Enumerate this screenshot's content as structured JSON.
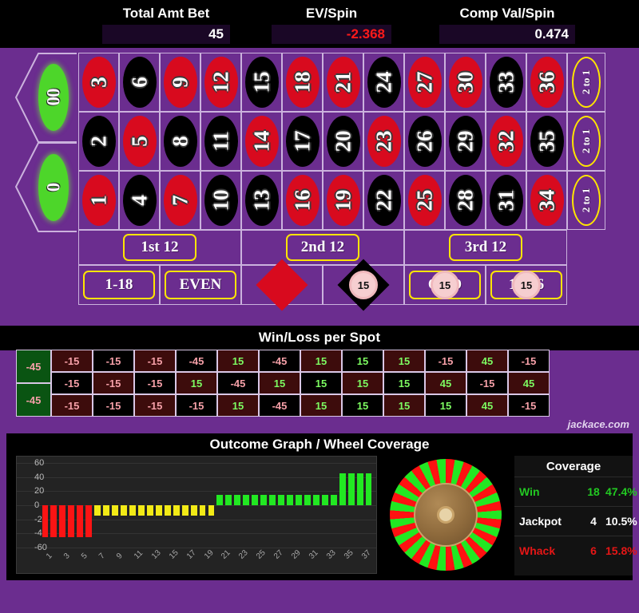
{
  "stats": {
    "items": [
      {
        "label": "Total Amt Bet",
        "value": "45",
        "negative": false
      },
      {
        "label": "EV/Spin",
        "value": "-2.368",
        "negative": true
      },
      {
        "label": "Comp Val/Spin",
        "value": "0.474",
        "negative": false
      }
    ]
  },
  "board": {
    "zeros": [
      {
        "label": "00",
        "name": "double-zero"
      },
      {
        "label": "0",
        "name": "zero"
      }
    ],
    "rows": [
      {
        "numbers": [
          {
            "n": "3",
            "c": "red"
          },
          {
            "n": "6",
            "c": "black"
          },
          {
            "n": "9",
            "c": "red"
          },
          {
            "n": "12",
            "c": "red"
          },
          {
            "n": "15",
            "c": "black"
          },
          {
            "n": "18",
            "c": "red"
          },
          {
            "n": "21",
            "c": "red"
          },
          {
            "n": "24",
            "c": "black"
          },
          {
            "n": "27",
            "c": "red"
          },
          {
            "n": "30",
            "c": "red"
          },
          {
            "n": "33",
            "c": "black"
          },
          {
            "n": "36",
            "c": "red"
          }
        ]
      },
      {
        "numbers": [
          {
            "n": "2",
            "c": "black"
          },
          {
            "n": "5",
            "c": "red"
          },
          {
            "n": "8",
            "c": "black"
          },
          {
            "n": "11",
            "c": "black"
          },
          {
            "n": "14",
            "c": "red"
          },
          {
            "n": "17",
            "c": "black"
          },
          {
            "n": "20",
            "c": "black"
          },
          {
            "n": "23",
            "c": "red"
          },
          {
            "n": "26",
            "c": "black"
          },
          {
            "n": "29",
            "c": "black"
          },
          {
            "n": "32",
            "c": "red"
          },
          {
            "n": "35",
            "c": "black"
          }
        ]
      },
      {
        "numbers": [
          {
            "n": "1",
            "c": "red"
          },
          {
            "n": "4",
            "c": "black"
          },
          {
            "n": "7",
            "c": "red"
          },
          {
            "n": "10",
            "c": "black"
          },
          {
            "n": "13",
            "c": "black"
          },
          {
            "n": "16",
            "c": "red"
          },
          {
            "n": "19",
            "c": "red"
          },
          {
            "n": "22",
            "c": "black"
          },
          {
            "n": "25",
            "c": "red"
          },
          {
            "n": "28",
            "c": "black"
          },
          {
            "n": "31",
            "c": "black"
          },
          {
            "n": "34",
            "c": "red"
          }
        ]
      }
    ],
    "column_bets": [
      "2 to 1",
      "2 to 1",
      "2 to 1"
    ],
    "dozens": [
      "1st 12",
      "2nd 12",
      "3rd 12"
    ],
    "outside": [
      {
        "label": "1-18",
        "kind": "text",
        "chip": null
      },
      {
        "label": "EVEN",
        "kind": "text",
        "chip": null
      },
      {
        "label": "RED",
        "kind": "diamond-red",
        "chip": null
      },
      {
        "label": "BLACK",
        "kind": "diamond-black",
        "chip": "15"
      },
      {
        "label": "ODD",
        "kind": "text",
        "chip": "15"
      },
      {
        "label": "19-36",
        "kind": "text",
        "chip": "15"
      }
    ]
  },
  "winloss": {
    "title": "Win/Loss per Spot",
    "zero_cells": [
      "-45",
      "-45"
    ],
    "rows": [
      [
        "-15",
        "-15",
        "-15",
        "-45",
        "15",
        "-45",
        "15",
        "15",
        "15",
        "-15",
        "45",
        "-15"
      ],
      [
        "-15",
        "-15",
        "-15",
        "15",
        "-45",
        "15",
        "15",
        "15",
        "15",
        "45",
        "-15",
        "45"
      ],
      [
        "-15",
        "-15",
        "-15",
        "-15",
        "15",
        "-45",
        "15",
        "15",
        "15",
        "15",
        "45",
        "-15"
      ]
    ],
    "watermark": "jackace.com"
  },
  "graph": {
    "title": "Outcome Graph / Wheel Coverage",
    "coverage": {
      "title": "Coverage",
      "rows": [
        {
          "label": "Win",
          "count": "18",
          "pct": "47.4%",
          "cls": "c-win"
        },
        {
          "label": "Jackpot",
          "count": "4",
          "pct": "10.5%",
          "cls": "c-jack"
        },
        {
          "label": "Whack",
          "count": "6",
          "pct": "15.8%",
          "cls": "c-whack"
        }
      ]
    }
  },
  "chart_data": {
    "type": "bar",
    "title": "Outcome Graph / Wheel Coverage",
    "xlabel": "",
    "ylabel": "",
    "ylim": [
      -60,
      60
    ],
    "yticks": [
      60,
      40,
      20,
      0,
      -20,
      -40,
      -60
    ],
    "xticks": [
      "1",
      "3",
      "5",
      "7",
      "9",
      "11",
      "13",
      "15",
      "17",
      "19",
      "21",
      "23",
      "25",
      "27",
      "29",
      "31",
      "33",
      "35",
      "37"
    ],
    "grid": true,
    "legend": null,
    "categories": [
      "1",
      "2",
      "3",
      "4",
      "5",
      "6",
      "7",
      "8",
      "9",
      "10",
      "11",
      "12",
      "13",
      "14",
      "15",
      "16",
      "17",
      "18",
      "19",
      "20",
      "21",
      "22",
      "23",
      "24",
      "25",
      "26",
      "27",
      "28",
      "29",
      "30",
      "31",
      "32",
      "33",
      "34",
      "35",
      "36",
      "37",
      "38"
    ],
    "values": [
      -45,
      -45,
      -45,
      -45,
      -45,
      -45,
      -15,
      -15,
      -15,
      -15,
      -15,
      -15,
      -15,
      -15,
      -15,
      -15,
      -15,
      -15,
      -15,
      -15,
      15,
      15,
      15,
      15,
      15,
      15,
      15,
      15,
      15,
      15,
      15,
      15,
      15,
      15,
      45,
      45,
      45,
      45
    ],
    "colors": [
      "#fb1414",
      "#fb1414",
      "#fb1414",
      "#fb1414",
      "#fb1414",
      "#fb1414",
      "#f2ea16",
      "#f2ea16",
      "#f2ea16",
      "#f2ea16",
      "#f2ea16",
      "#f2ea16",
      "#f2ea16",
      "#f2ea16",
      "#f2ea16",
      "#f2ea16",
      "#f2ea16",
      "#f2ea16",
      "#f2ea16",
      "#f2ea16",
      "#22e822",
      "#22e822",
      "#22e822",
      "#22e822",
      "#22e822",
      "#22e822",
      "#22e822",
      "#22e822",
      "#22e822",
      "#22e822",
      "#22e822",
      "#22e822",
      "#22e822",
      "#22e822",
      "#22e822",
      "#22e822",
      "#22e822",
      "#22e822"
    ]
  }
}
